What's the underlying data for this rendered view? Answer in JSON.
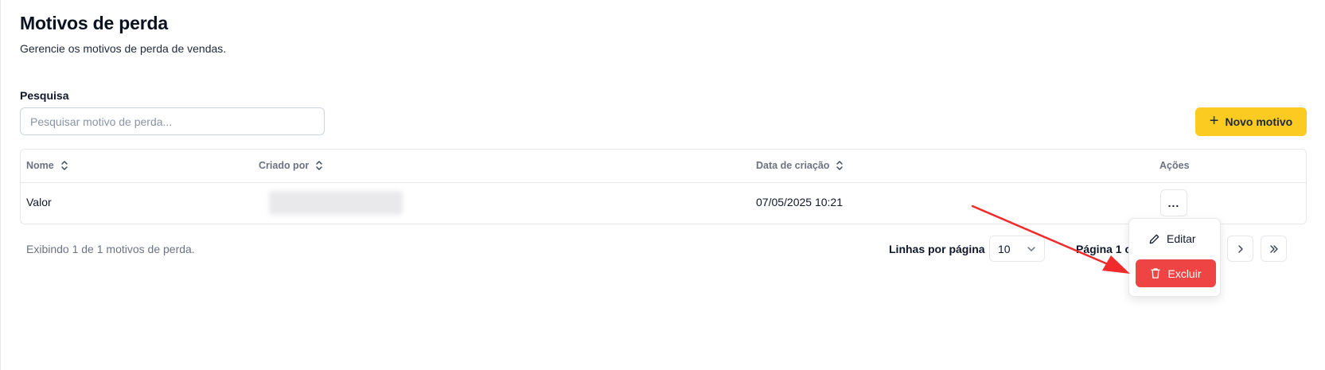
{
  "page": {
    "title": "Motivos de perda",
    "subtitle": "Gerencie os motivos de perda de vendas."
  },
  "search": {
    "label": "Pesquisa",
    "placeholder": "Pesquisar motivo de perda...",
    "value": ""
  },
  "toolbar": {
    "new_button_label": "Novo motivo",
    "new_button_icon": "plus-icon",
    "accent_color": "#fbcb22"
  },
  "table": {
    "columns": [
      {
        "label": "Nome",
        "sortable": true
      },
      {
        "label": "Criado por",
        "sortable": true
      },
      {
        "label": "Data de criação",
        "sortable": true
      },
      {
        "label": "Ações",
        "sortable": false
      }
    ],
    "rows": [
      {
        "name": "Valor",
        "created_by": "",
        "created_at": "07/05/2025 10:21",
        "actions_label": "..."
      }
    ]
  },
  "footer": {
    "summary": "Exibindo 1 de 1 motivos de perda.",
    "rows_per_page_label": "Linhas por página",
    "rows_per_page_value": "10",
    "page_indicator": "Página 1 c"
  },
  "action_menu": {
    "edit_label": "Editar",
    "edit_icon": "pencil-icon",
    "delete_label": "Excluir",
    "delete_icon": "trash-icon",
    "delete_color": "#ef4444"
  },
  "annotation": {
    "arrow_color": "#ef2b2b"
  }
}
